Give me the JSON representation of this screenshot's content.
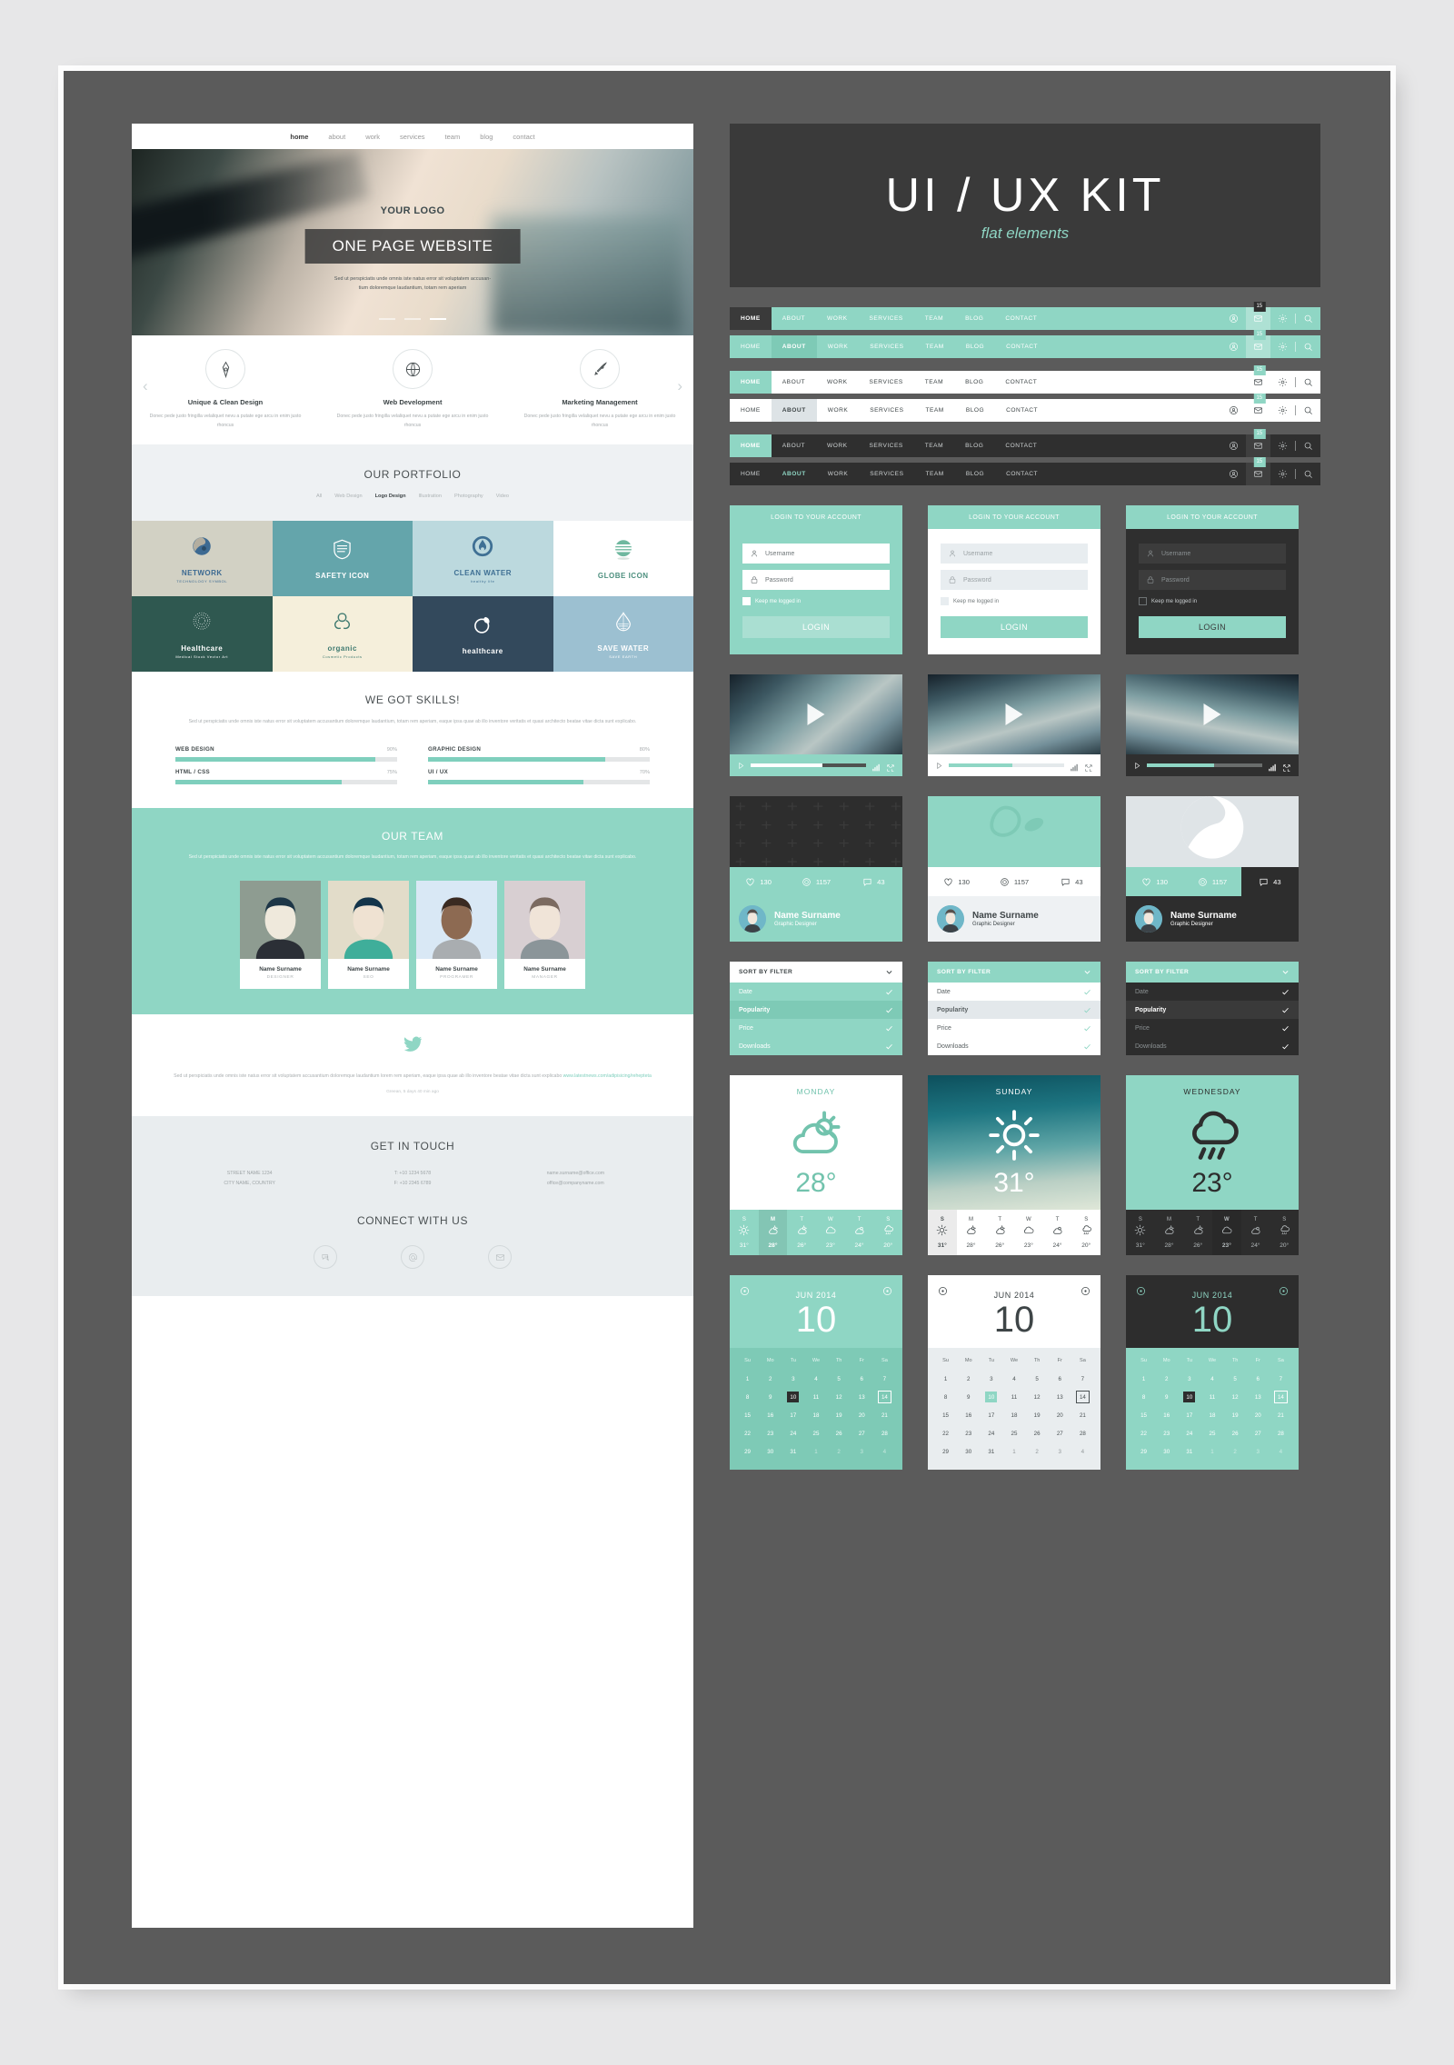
{
  "colors": {
    "accent": "#8fd6c4",
    "accent_dark": "#71c4b0",
    "dark": "#3a3a3a",
    "canvas": "#5b5b5b",
    "light": "#eef1f3",
    "page_bg": "#e7e7e8"
  },
  "kit_header": {
    "title": "UI / UX KIT",
    "subtitle": "flat elements"
  },
  "website": {
    "nav": [
      {
        "label": "home",
        "active": true
      },
      {
        "label": "about",
        "active": false
      },
      {
        "label": "work",
        "active": false
      },
      {
        "label": "services",
        "active": false
      },
      {
        "label": "team",
        "active": false
      },
      {
        "label": "blog",
        "active": false
      },
      {
        "label": "contact",
        "active": false
      }
    ],
    "hero": {
      "logo": "YOUR LOGO",
      "headline": "ONE PAGE WEBSITE",
      "subtext": "Sed ut perspiciatis unde omnis iste natus error sit voluptatem accusan-\ntium doloremque laudantium, totam rem aperiam",
      "slides": 3,
      "active_slide": 3
    },
    "features": [
      {
        "title": "Unique & Clean Design",
        "icon": "pen-nib-icon",
        "text": "Donec pede justo fringilla velaliquet nevu a putate ege arcu in enim justo rhoncus"
      },
      {
        "title": "Web Development",
        "icon": "globe-icon",
        "text": "Donec pede justo fringilla velaliquet nevu a putate ege arcu in enim justo rhoncus"
      },
      {
        "title": "Marketing Management",
        "icon": "rocket-icon",
        "text": "Donec pede justo fringilla velaliquet nevu a putate ege arcu in enim justo rhoncus"
      }
    ],
    "portfolio": {
      "title": "OUR PORTFOLIO",
      "filters": [
        {
          "label": "All",
          "active": false
        },
        {
          "label": "Web Design",
          "active": false
        },
        {
          "label": "Logo Design",
          "active": true
        },
        {
          "label": "Illustration",
          "active": false
        },
        {
          "label": "Photography",
          "active": false
        },
        {
          "label": "Video",
          "active": false
        }
      ],
      "tiles": [
        {
          "title": "NETWORK",
          "sub": "TECHNOLOGY SYMBOL",
          "bg": "#d2d1c4",
          "fg": "#3d6a92",
          "icon": "people-globe-icon"
        },
        {
          "title": "SAFETY ICON",
          "sub": "",
          "bg": "#64a5ab",
          "fg": "#ffffff",
          "icon": "shield-icon"
        },
        {
          "title": "CLEAN WATER",
          "sub": "healthy life",
          "bg": "#bcd9de",
          "fg": "#3f7094",
          "icon": "water-drop-circle-icon"
        },
        {
          "title": "GLOBE ICON",
          "sub": "",
          "bg": "#ffffff",
          "fg": "#4c8f7e",
          "icon": "striped-globe-icon"
        },
        {
          "title": "Healthcare",
          "sub": "Medical Stock Vector Art",
          "bg": "#2f5850",
          "fg": "#ffffff",
          "icon": "dotted-sphere-icon"
        },
        {
          "title": "organic",
          "sub": "Cosmetic Products",
          "bg": "#f5efdb",
          "fg": "#3f7a70",
          "icon": "flower-leaf-icon"
        },
        {
          "title": "healthcare",
          "sub": "",
          "bg": "#33495c",
          "fg": "#ffffff",
          "icon": "leaf-circle-icon"
        },
        {
          "title": "SAVE WATER",
          "sub": "SAVE EARTH",
          "bg": "#9cc0d1",
          "fg": "#ffffff",
          "icon": "drop-grid-icon"
        }
      ]
    },
    "skills": {
      "title": "WE GOT SKILLS!",
      "lead": "Sed ut perspiciatis unde omnis iste natus error sit voluptatem accusantium doloremque laudantium, totam rem aperiam, eaque ipsa quae ab illo inventore veritatis et quasi architecto beatae vitae dicta sunt explicabo.",
      "bars": [
        {
          "name": "WEB DESIGN",
          "percent": "90%",
          "value": 90
        },
        {
          "name": "GRAPHIC DESIGN",
          "percent": "80%",
          "value": 80
        },
        {
          "name": "HTML / CSS",
          "percent": "75%",
          "value": 75
        },
        {
          "name": "UI / UX",
          "percent": "70%",
          "value": 70
        }
      ]
    },
    "team": {
      "title": "OUR TEAM",
      "lead": "Sed ut perspiciatis unde omnis iste natus error sit voluptatem accusantium doloremque laudantium, totam rem aperiam, eaque ipsa quae ab illo inventore veritatis et quasi architecto beatae vitae dicta sunt explicabo.",
      "members": [
        {
          "name": "Name Surname",
          "role": "DESIGNER",
          "bg": "#8e9c91",
          "skin": "#efe9dc",
          "shirt": "#2b2f36",
          "hair": "#1d3647"
        },
        {
          "name": "Name Surname",
          "role": "SEO",
          "bg": "#e2dcc9",
          "skin": "#efe2d2",
          "shirt": "#3fae9a",
          "hair": "#13344a"
        },
        {
          "name": "Name Surname",
          "role": "PROGRAMER",
          "bg": "#d9e8f5",
          "skin": "#8d6a52",
          "shirt": "#a9adb0",
          "hair": "#3a2a21"
        },
        {
          "name": "Name Surname",
          "role": "MANAGER",
          "bg": "#d8cfd2",
          "skin": "#f0e4d8",
          "shirt": "#8b9599",
          "hair": "#7b6a60"
        }
      ]
    },
    "tweet": {
      "text": "Sed ut perspiciatis unde omnis iste natus error sit voluptatem accusantium doloremque laudantium lorem rem aperiam, eaque ipsa quae ab illo inventore beatae vitae dicta sunt explicabo ",
      "link": "www.latestnews.com/adipisicing/rehepteta",
      "time": "Greean, 5 days 40 min ago"
    },
    "contact": {
      "title": "GET IN TOUCH",
      "columns": [
        "STREET NAME 1234\nCITY NAME, COUNTRY",
        "T: +10 1234 5678\nF: +10 2345 6789",
        "name.surname@office.com\noffice@companyname.com"
      ],
      "connect_title": "CONNECT WITH US",
      "social": [
        "chat-bubble-icon",
        "at-sign-icon",
        "envelope-icon"
      ]
    }
  },
  "navbars": {
    "links": [
      "HOME",
      "ABOUT",
      "WORK",
      "SERVICES",
      "TEAM",
      "BLOG",
      "CONTACT"
    ],
    "badge": "15",
    "icons": [
      "user-icon",
      "envelope-icon",
      "gear-icon",
      "search-icon"
    ],
    "variants": [
      {
        "style": "teal-dark-active",
        "active": "HOME",
        "bg": "#8fd6c4",
        "text": "#ffffff",
        "active_bg": "#3a3a3a",
        "active_text": "#ffffff"
      },
      {
        "style": "teal-tint-active",
        "active": "ABOUT",
        "bg": "#8fd6c4",
        "text": "#ffffff",
        "active_bg": "#7ecab6",
        "active_text": "#ffffff"
      },
      {
        "style": "white-teal-active",
        "active": "HOME",
        "bg": "#ffffff",
        "text": "#3e4547",
        "active_bg": "#8fd6c4",
        "active_text": "#ffffff"
      },
      {
        "style": "white-grey-active",
        "active": "ABOUT",
        "bg": "#ffffff",
        "text": "#3e4547",
        "active_bg": "#dde3e6",
        "active_text": "#3e4547"
      },
      {
        "style": "dark-teal-active",
        "active": "HOME",
        "bg": "#2f2f2f",
        "text": "#cdd1d2",
        "active_bg": "#8fd6c4",
        "active_text": "#ffffff"
      },
      {
        "style": "dark-teal-text",
        "active": "ABOUT",
        "bg": "#2f2f2f",
        "text": "#cdd1d2",
        "active_bg": "#2f2f2f",
        "active_text": "#8fd6c4"
      }
    ]
  },
  "login_cards": {
    "title": "LOGIN TO YOUR ACCOUNT",
    "username_placeholder": "Username",
    "password_placeholder": "Password",
    "keep_label": "Keep me logged in",
    "button": "LOGIN",
    "variants": [
      {
        "theme": "teal",
        "body_bg": "#8fd6c4",
        "field_bg": "#ffffff",
        "field_text": "#6f7678",
        "btn_bg": "#aadfd2",
        "btn_text": "#ffffff"
      },
      {
        "theme": "white",
        "body_bg": "#ffffff",
        "field_bg": "#e8edf0",
        "field_text": "#9aa1a4",
        "btn_bg": "#8fd6c4",
        "btn_text": "#ffffff"
      },
      {
        "theme": "dark",
        "body_bg": "#2f2f2f",
        "field_bg": "#3c3c3c",
        "field_text": "#8a9092",
        "btn_bg": "#8fd6c4",
        "btn_text": "#3a3a3a"
      }
    ]
  },
  "video_cards": [
    {
      "theme": "teal",
      "bar_bg": "#8fd6c4",
      "progress": 62,
      "fill": "#ffffff",
      "track": "#4f5250"
    },
    {
      "theme": "white",
      "bar_bg": "#ffffff",
      "progress": 55,
      "fill": "#8fd6c4",
      "track": "#e4e9eb"
    },
    {
      "theme": "dark",
      "bar_bg": "#2f2f2f",
      "progress": 58,
      "fill": "#8fd6c4",
      "track": "#6a6d6c"
    }
  ],
  "profile_cards": {
    "likes": "130",
    "views": "1157",
    "comments": "43",
    "name": "Name Surname",
    "role": "Graphic Designer",
    "variants": [
      {
        "theme": "teal",
        "img_bg": "#2d2d2d",
        "stats_bg": "#8fd6c4",
        "stats_text": "#ffffff",
        "user_bg": "#8fd6c4",
        "user_text": "#ffffff"
      },
      {
        "theme": "white",
        "img_bg": "#8fd6c4",
        "stats_bg": "#ffffff",
        "stats_text": "#4a5153",
        "user_bg": "#eef1f3",
        "user_text": "#3e4547"
      },
      {
        "theme": "dark",
        "img_bg": "#dfe4e7",
        "stats_bg": "#8fd6c4",
        "stats_text": "#ffffff",
        "user_bg": "#2d2d2d",
        "user_text": "#ffffff"
      }
    ]
  },
  "sorters": {
    "header": "SORT BY FILTER",
    "items": [
      "Date",
      "Popularity",
      "Price",
      "Downloads"
    ],
    "variants": [
      {
        "theme": "teal",
        "head_bg": "#ffffff",
        "head_text": "#3e4547",
        "item_bg": "#8fd6c4",
        "item_text": "#ffffff",
        "hl": "Popularity",
        "hl_bg": "#7ecab6"
      },
      {
        "theme": "white",
        "head_bg": "#8fd6c4",
        "head_text": "#ffffff",
        "item_bg": "#ffffff",
        "item_text": "#5a6163",
        "hl": "Popularity",
        "hl_bg": "#e3e8eb"
      },
      {
        "theme": "dark",
        "head_bg": "#8fd6c4",
        "head_text": "#ffffff",
        "item_bg": "#2d2d2d",
        "item_text": "#8b9193",
        "hl": "Popularity",
        "hl_bg": "#3a3a3a"
      }
    ]
  },
  "weather": {
    "forecast_days": [
      "S",
      "M",
      "T",
      "W",
      "T",
      "S"
    ],
    "forecast_temps": [
      "31°",
      "28°",
      "26°",
      "23°",
      "24°",
      "20°"
    ],
    "forecast_icons": [
      "sun-icon",
      "sun-cloud-icon",
      "sun-cloud-icon",
      "cloud-icon",
      "cloud-cloud-icon",
      "rain-icon"
    ],
    "cards": [
      {
        "day": "MONDAY",
        "temp": "28°",
        "icon": "sun-behind-cloud-icon",
        "theme": "white",
        "top_bg": "#ffffff",
        "accent": "#72c3ad",
        "fore_bg": "#8fd6c4",
        "fore_text": "#ffffff",
        "hl_index": 1
      },
      {
        "day": "SUNDAY",
        "temp": "31°",
        "icon": "sun-icon",
        "theme": "photo",
        "top_bg": "#1c6570",
        "accent": "#ffffff",
        "fore_bg": "#ffffff",
        "fore_text": "#4a5153",
        "hl_index": 0
      },
      {
        "day": "WEDNESDAY",
        "temp": "23°",
        "icon": "rain-cloud-icon",
        "theme": "teal",
        "top_bg": "#8fd6c4",
        "accent": "#2d2d2d",
        "fore_bg": "#2d2d2d",
        "fore_text": "#b4babc",
        "hl_index": 3
      }
    ]
  },
  "calendars": {
    "month": "JUN 2014",
    "big_day": "10",
    "weekdays": [
      "Su",
      "Mo",
      "Tu",
      "We",
      "Th",
      "Fr",
      "Sa"
    ],
    "weeks": [
      [
        "1",
        "2",
        "3",
        "4",
        "5",
        "6",
        "7"
      ],
      [
        "8",
        "9",
        "10",
        "11",
        "12",
        "13",
        "14"
      ],
      [
        "15",
        "16",
        "17",
        "18",
        "19",
        "20",
        "21"
      ],
      [
        "22",
        "23",
        "24",
        "25",
        "26",
        "27",
        "28"
      ],
      [
        "29",
        "30",
        "31",
        "1",
        "2",
        "3",
        "4"
      ]
    ],
    "selected": "10",
    "outlined": "14",
    "variants": [
      {
        "theme": "teal",
        "head_bg": "#8fd6c4",
        "head_text": "#ffffff",
        "body_bg": "#7ecab6",
        "body_text": "#ffffff",
        "sel_bg": "#2d2d2d",
        "sel_text": "#ffffff"
      },
      {
        "theme": "white",
        "head_bg": "#ffffff",
        "head_text": "#3e4547",
        "body_bg": "#e9edef",
        "body_text": "#4a5153",
        "sel_bg": "#8fd6c4",
        "sel_text": "#ffffff"
      },
      {
        "theme": "dark",
        "head_bg": "#2d2d2d",
        "head_text": "#8fd6c4",
        "body_bg": "#8fd6c4",
        "body_text": "#ffffff",
        "sel_bg": "#2d2d2d",
        "sel_text": "#ffffff"
      }
    ]
  }
}
